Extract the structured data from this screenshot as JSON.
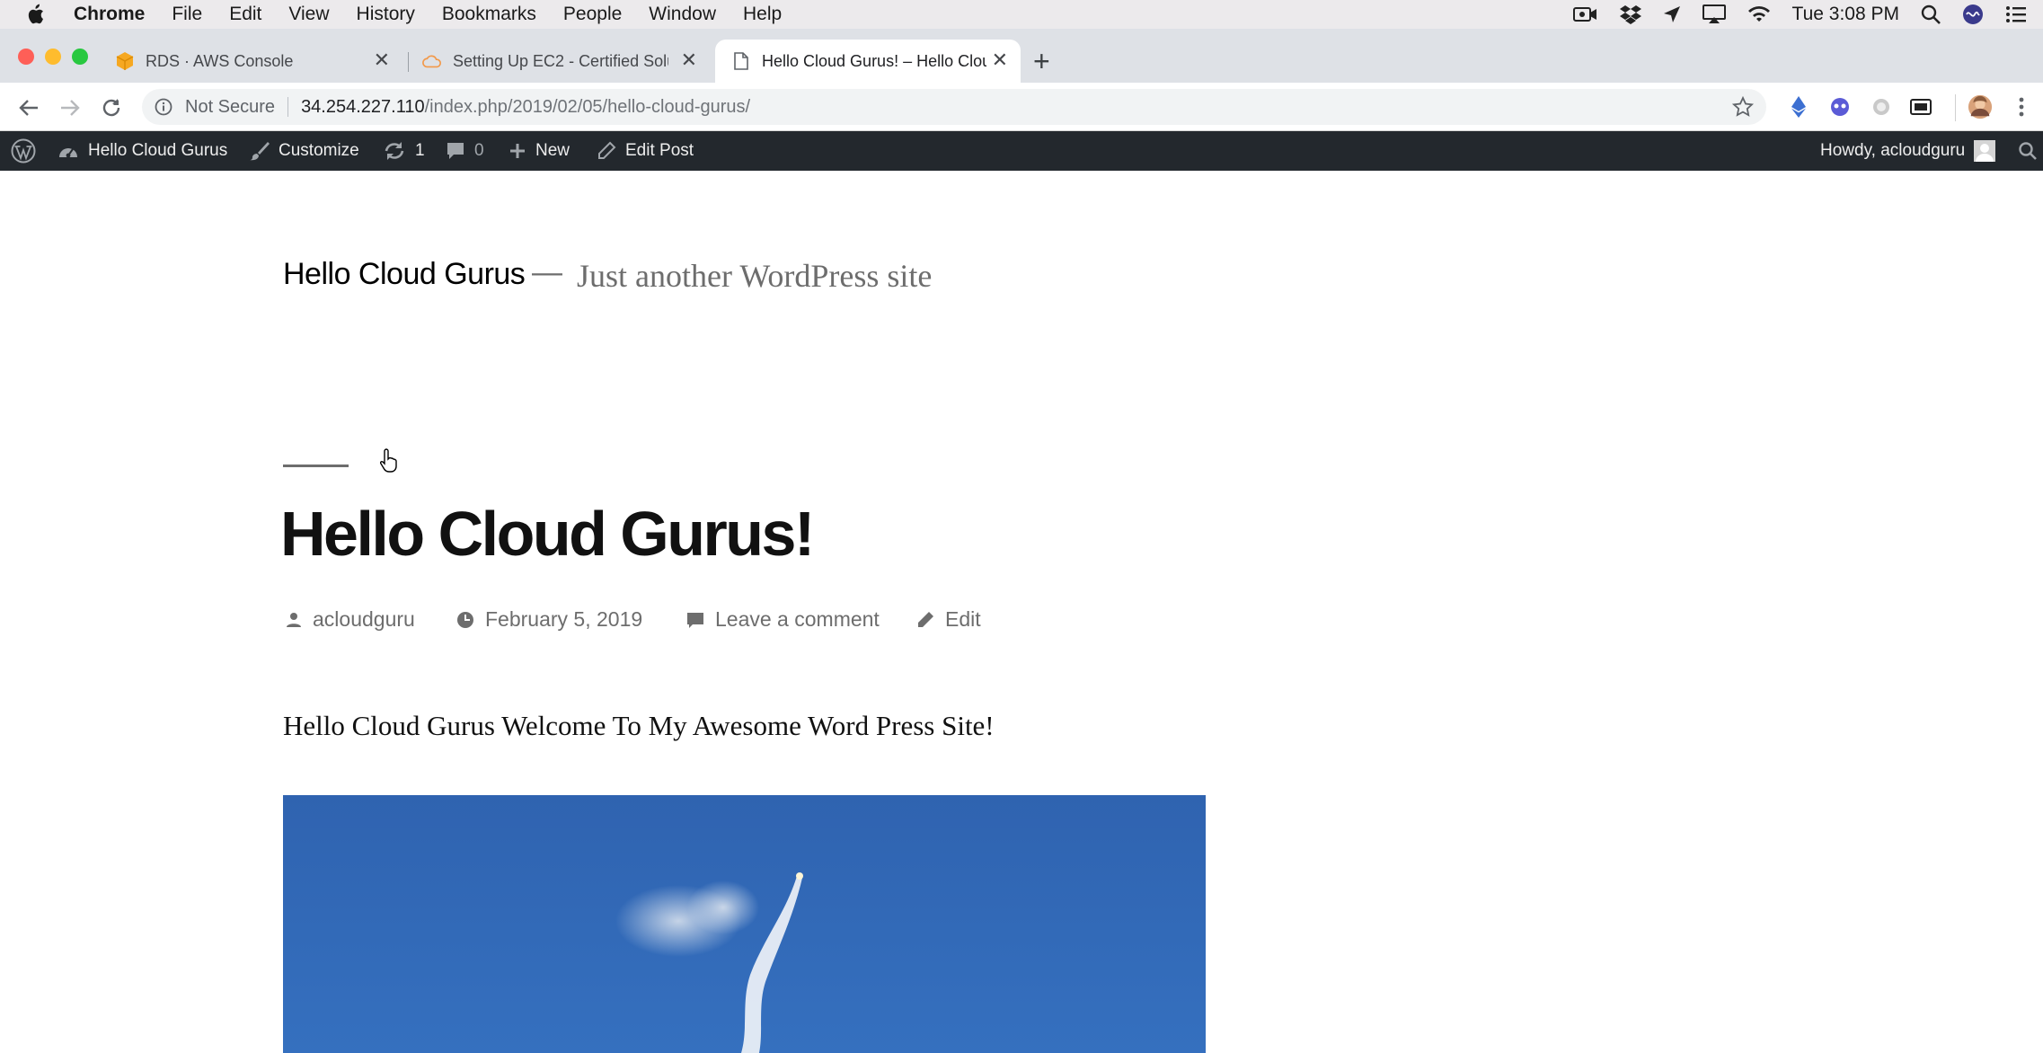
{
  "menubar": {
    "app": "Chrome",
    "items": [
      "File",
      "Edit",
      "View",
      "History",
      "Bookmarks",
      "People",
      "Window",
      "Help"
    ],
    "clock": "Tue 3:08 PM"
  },
  "tabs": [
    {
      "title": "RDS · AWS Console",
      "icon": "aws-box-icon",
      "active": false
    },
    {
      "title": "Setting Up EC2 - Certified Solu",
      "icon": "cloud-icon",
      "active": false
    },
    {
      "title": "Hello Cloud Gurus! – Hello Clou",
      "icon": "page-icon",
      "active": true
    }
  ],
  "toolbar": {
    "security": "Not Secure",
    "url_host": "34.254.227.110",
    "url_path": "/index.php/2019/02/05/hello-cloud-gurus/"
  },
  "adminbar": {
    "site_name": "Hello Cloud Gurus",
    "customize": "Customize",
    "updates": "1",
    "comments": "0",
    "new": "New",
    "edit_post": "Edit Post",
    "howdy": "Howdy, acloudguru"
  },
  "site": {
    "title": "Hello Cloud Gurus",
    "dash": "—",
    "description": "Just another WordPress site"
  },
  "post": {
    "title": "Hello Cloud Gurus!",
    "author": "acloudguru",
    "date": "February 5, 2019",
    "comment_link": "Leave a comment",
    "edit_link": "Edit",
    "body": "Hello Cloud Gurus Welcome To My Awesome Word Press Site!"
  },
  "colors": {
    "adminbar_bg": "#23282d",
    "image_sky": "#3570bf"
  }
}
